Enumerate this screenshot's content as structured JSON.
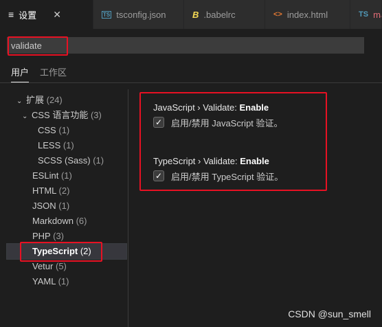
{
  "tabs": [
    {
      "icon": "≡",
      "label": "设置",
      "close": "✕",
      "active": true
    },
    {
      "icon": "TS",
      "label": "tsconfig.json",
      "active": false
    },
    {
      "icon": "B",
      "label": ".babelrc",
      "active": false
    },
    {
      "icon": "<>",
      "label": "index.html",
      "active": false
    },
    {
      "icon": "TS",
      "label": "ma",
      "active": false
    }
  ],
  "colors": {
    "ts": "#519aba",
    "babel": "#f5da55",
    "html": "#e37933",
    "partial_tab": "#e06c75",
    "highlight": "#e81123"
  },
  "search": {
    "value": "validate",
    "placeholder": ""
  },
  "scopes": {
    "user": "用户",
    "workspace": "工作区"
  },
  "toc": [
    {
      "label": "扩展",
      "count": "(24)",
      "chev": "⌄"
    },
    {
      "label": "CSS 语言功能",
      "count": "(3)",
      "chev": "⌄"
    },
    {
      "label": "CSS",
      "count": "(1)"
    },
    {
      "label": "LESS",
      "count": "(1)"
    },
    {
      "label": "SCSS (Sass)",
      "count": "(1)"
    },
    {
      "label": "ESLint",
      "count": "(1)"
    },
    {
      "label": "HTML",
      "count": "(2)"
    },
    {
      "label": "JSON",
      "count": "(1)"
    },
    {
      "label": "Markdown",
      "count": "(6)"
    },
    {
      "label": "PHP",
      "count": "(3)"
    },
    {
      "label": "TypeScript",
      "count": "(2)",
      "selected": true
    },
    {
      "label": "Vetur",
      "count": "(5)"
    },
    {
      "label": "YAML",
      "count": "(1)"
    }
  ],
  "settings": [
    {
      "category": "JavaScript › Validate: ",
      "name": "Enable",
      "checked": true,
      "check": "✓",
      "description": "启用/禁用 JavaScript 验证。"
    },
    {
      "category": "TypeScript › Validate: ",
      "name": "Enable",
      "checked": true,
      "check": "✓",
      "description": "启用/禁用 TypeScript 验证。"
    }
  ],
  "watermark": "CSDN @sun_smell"
}
